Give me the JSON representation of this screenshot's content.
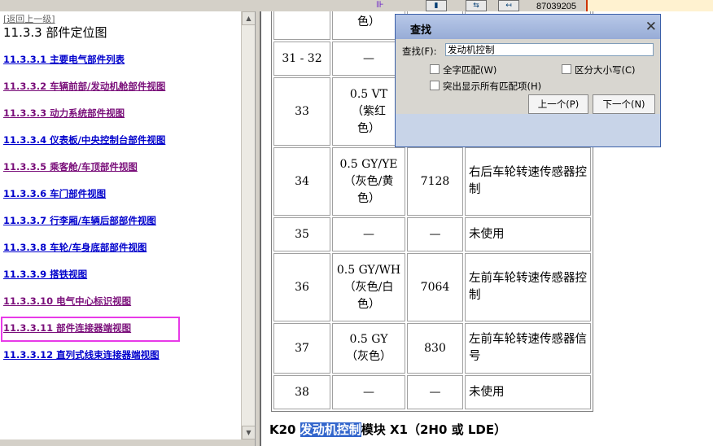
{
  "topbar": {
    "number": "87039205"
  },
  "nav": {
    "back": "[返回上一级]",
    "title": "11.3.3 部件定位图",
    "items": [
      {
        "label": "11.3.3.1 主要电气部件列表",
        "visited": false
      },
      {
        "label": "11.3.3.2 车辆前部/发动机舱部件视图",
        "visited": true
      },
      {
        "label": "11.3.3.3 动力系统部件视图",
        "visited": true
      },
      {
        "label": "11.3.3.4 仪表板/中央控制台部件视图",
        "visited": false
      },
      {
        "label": "11.3.3.5 乘客舱/车顶部件视图",
        "visited": true
      },
      {
        "label": "11.3.3.6 车门部件视图",
        "visited": false
      },
      {
        "label": "11.3.3.7 行李厢/车辆后部部件视图",
        "visited": false
      },
      {
        "label": "11.3.3.8 车轮/车身底部部件视图",
        "visited": false
      },
      {
        "label": "11.3.3.9 搭铁视图",
        "visited": false
      },
      {
        "label": "11.3.3.10 电气中心标识视图",
        "visited": true
      },
      {
        "label": "11.3.3.11 部件连接器端视图",
        "visited": true
      },
      {
        "label": "11.3.3.12 直列式线束连接器端视图",
        "visited": false
      }
    ]
  },
  "table": {
    "rows": [
      {
        "pin": "",
        "wire": "色）",
        "circuit": "",
        "function": ""
      },
      {
        "pin": "31 - 32",
        "wire": "—",
        "circuit": "",
        "function": ""
      },
      {
        "pin": "33",
        "wire": "0.5 VT\n（紫红\n色）",
        "circuit": "",
        "function": ""
      },
      {
        "pin": "34",
        "wire": "0.5 GY/YE\n（灰色/黄\n色）",
        "circuit": "7128",
        "function": "右后车轮转速传感器控制"
      },
      {
        "pin": "35",
        "wire": "—",
        "circuit": "—",
        "function": "未使用"
      },
      {
        "pin": "36",
        "wire": "0.5 GY/WH\n（灰色/白\n色）",
        "circuit": "7064",
        "function": "左前车轮转速传感器控制"
      },
      {
        "pin": "37",
        "wire": "0.5 GY\n（灰色）",
        "circuit": "830",
        "function": "左前车轮转速传感器信号"
      },
      {
        "pin": "38",
        "wire": "—",
        "circuit": "—",
        "function": "未使用"
      }
    ]
  },
  "caption": {
    "prefix": "K20 ",
    "highlight": "发动机控制",
    "suffix": "模块 X1（2H0 或 LDE）"
  },
  "find_dialog": {
    "title": "查找",
    "find_label": "查找(F):",
    "find_value": "发动机控制",
    "whole_word": "全字匹配(W)",
    "match_case": "区分大小写(C)",
    "highlight_all": "突出显示所有匹配项(H)",
    "prev_button": "上一个(P)",
    "next_button": "下一个(N)",
    "close_glyph": "✕"
  },
  "colors": {
    "link_unvisited": "#0000cc",
    "link_visited": "#7a0f7a",
    "highlight_box": "#e83ae8",
    "search_hit": "#3366cc"
  }
}
